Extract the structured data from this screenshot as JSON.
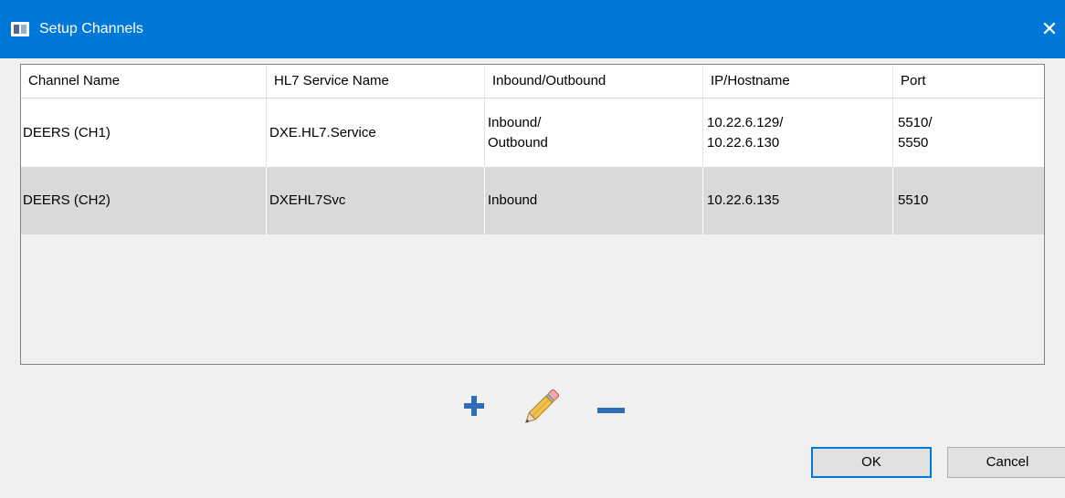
{
  "window": {
    "title": "Setup Channels",
    "close_glyph": "✕",
    "accent_color": "#0078d7"
  },
  "grid": {
    "columns": [
      "Channel Name",
      "HL7 Service Name",
      "Inbound/Outbound",
      "IP/Hostname",
      "Port"
    ],
    "rows": [
      {
        "channel_name": "DEERS (CH1)",
        "service_name": "DXE.HL7.Service",
        "direction": "Inbound/\nOutbound",
        "ip_hostname": "10.22.6.129/\n10.22.6.130",
        "port": "5510/\n5550",
        "selected": false
      },
      {
        "channel_name": "DEERS (CH2)",
        "service_name": "DXEHL7Svc",
        "direction": "Inbound",
        "ip_hostname": "10.22.6.135",
        "port": "5510",
        "selected": true
      }
    ]
  },
  "toolbar": {
    "add_icon": "plus-icon",
    "edit_icon": "pencil-icon",
    "remove_icon": "minus-icon"
  },
  "buttons": {
    "ok_label": "OK",
    "cancel_label": "Cancel"
  }
}
